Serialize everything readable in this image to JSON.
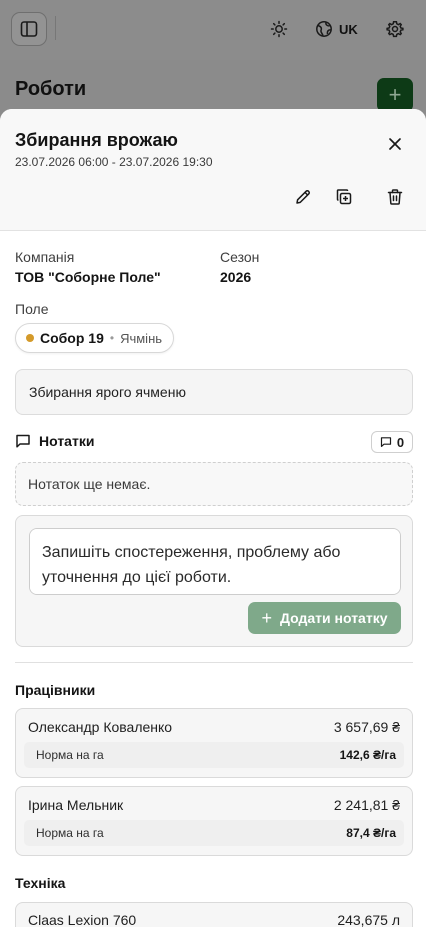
{
  "topbar": {
    "lang_label": "UK"
  },
  "background": {
    "page_title": "Роботи",
    "add_label": "+"
  },
  "sheet": {
    "title": "Збирання врожаю",
    "date_range": "23.07.2026 06:00 - 23.07.2026 19:30",
    "company_label": "Компанія",
    "company_value": "ТОВ \"Соборне Поле\"",
    "season_label": "Сезон",
    "season_value": "2026",
    "field_label": "Поле",
    "field": {
      "name": "Собор 19",
      "separator": "•",
      "crop": "Ячмінь",
      "dot_color": "#d49a2a"
    },
    "description": "Збирання ярого ячменю",
    "notes": {
      "title": "Нотатки",
      "count": "0",
      "empty_text": "Нотаток ще немає.",
      "input_placeholder": "Запишіть спостереження, проблему або уточнення до цієї роботи.",
      "add_button": "Додати нотатку",
      "add_button_icon": "+"
    },
    "workers": {
      "title": "Працівники",
      "norm_label": "Норма на га",
      "items": [
        {
          "name": "Олександр Коваленко",
          "amount": "3 657,69 ₴",
          "norm": "142,6 ₴/га"
        },
        {
          "name": "Ірина Мельник",
          "amount": "2 241,81 ₴",
          "norm": "87,4 ₴/га"
        }
      ]
    },
    "machinery": {
      "title": "Техніка",
      "items": [
        {
          "name": "Claas Lexion 760",
          "amount": "243,675 л"
        }
      ]
    }
  },
  "colors": {
    "accent_button": "#7fa98a",
    "add_button_bg": "#0d3a16"
  }
}
